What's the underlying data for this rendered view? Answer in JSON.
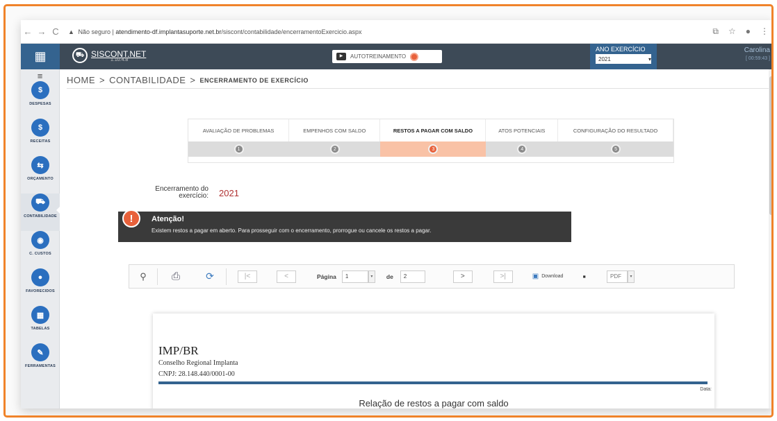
{
  "browser": {
    "security": "Não seguro",
    "url_domain": "atendimento-df.implantasuporte.net.br",
    "url_path": "/siscont/contabilidade/encerramentoExercicio.aspx"
  },
  "topbar": {
    "logo": "SISCONT.NET",
    "version": "1.10.4.8",
    "autotreinamento": "AUTOTREINAMENTO",
    "ano_label": "ANO EXERCÍCIO",
    "ano_value": "2021",
    "user_name": "Carolina",
    "user_timer": "[ 00:59:43 ]"
  },
  "sidebar": {
    "items": [
      {
        "label": "DESPESAS",
        "icon": "$"
      },
      {
        "label": "RECEITAS",
        "icon": "$"
      },
      {
        "label": "ORÇAMENTO",
        "icon": "⇆"
      },
      {
        "label": "CONTABILIDADE",
        "icon": "⛟"
      },
      {
        "label": "C. CUSTOS",
        "icon": "◉"
      },
      {
        "label": "FAVORECIDOS",
        "icon": "●"
      },
      {
        "label": "TABELAS",
        "icon": "▦"
      },
      {
        "label": "FERRAMENTAS",
        "icon": "✎"
      }
    ]
  },
  "breadcrumb": {
    "home": "HOME",
    "sep1": ">",
    "section": "CONTABILIDADE",
    "sep2": ">",
    "current": "ENCERRAMENTO DE EXERCÍCIO"
  },
  "steps": [
    {
      "label": "AVALIAÇÃO DE PROBLEMAS",
      "num": "1"
    },
    {
      "label": "EMPENHOS COM SALDO",
      "num": "2"
    },
    {
      "label": "RESTOS A PAGAR COM SALDO",
      "num": "3"
    },
    {
      "label": "ATOS POTENCIAIS",
      "num": "4"
    },
    {
      "label": "CONFIGURAÇÃO DO RESULTADO",
      "num": "5"
    }
  ],
  "encerramento": {
    "label": "Encerramento do exercício:",
    "value": "2021"
  },
  "alert": {
    "icon": "!",
    "title": "Atenção!",
    "message": "Existem restos a pagar em aberto. Para prosseguir com o encerramento, prorrogue ou cancele os restos a pagar."
  },
  "toolbar": {
    "page_label": "Página",
    "page_value": "1",
    "of_label": "de",
    "total_pages": "2",
    "download_label": "Download",
    "format": "PDF"
  },
  "report": {
    "org": "IMP/BR",
    "org_name": "Conselho Regional Implanta",
    "cnpj": "CNPJ: 28.148.440/0001-00",
    "data_label": "Data:",
    "title": "Relação de restos a pagar com saldo"
  }
}
